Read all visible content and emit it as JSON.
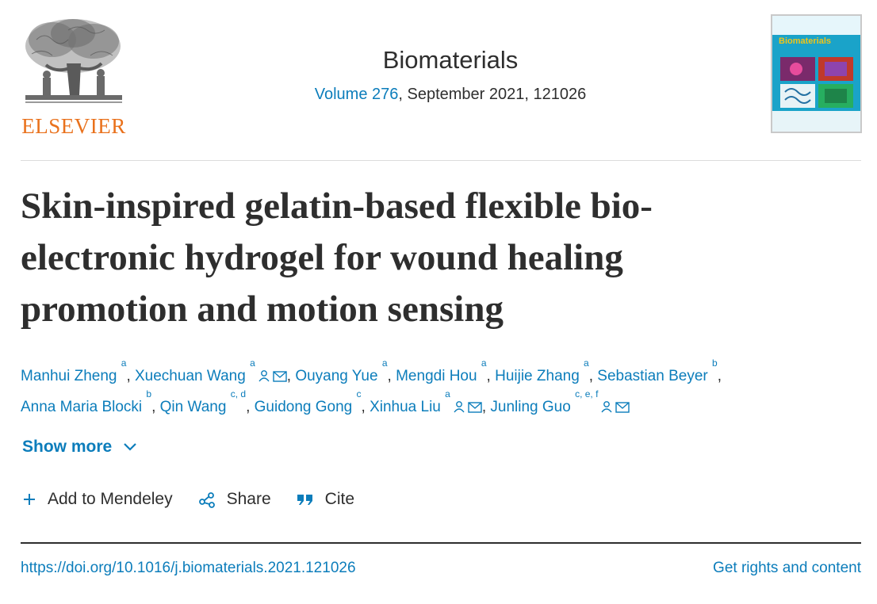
{
  "header": {
    "publisher": "ELSEVIER",
    "journal_title": "Biomaterials",
    "volume_link": "Volume 276",
    "issue_info": ", September 2021, 121026",
    "cover_title": "Biomaterials"
  },
  "article": {
    "title_lines": [
      "Skin-inspired gelatin-based flexible bio-",
      "electronic hydrogel for wound healing",
      "promotion and motion sensing"
    ]
  },
  "authors": [
    {
      "name": "Manhui Zheng",
      "aff": "a",
      "icons": false
    },
    {
      "name": "Xuechuan Wang",
      "aff": "a",
      "icons": true
    },
    {
      "name": "Ouyang Yue",
      "aff": "a",
      "icons": false
    },
    {
      "name": "Mengdi Hou",
      "aff": "a",
      "icons": false
    },
    {
      "name": "Huijie Zhang",
      "aff": "a",
      "icons": false
    },
    {
      "name": "Sebastian Beyer",
      "aff": "b",
      "icons": false
    },
    {
      "name": "Anna Maria Blocki",
      "aff": "b",
      "icons": false
    },
    {
      "name": "Qin Wang",
      "aff": "c, d",
      "icons": false
    },
    {
      "name": "Guidong Gong",
      "aff": "c",
      "icons": false
    },
    {
      "name": "Xinhua Liu",
      "aff": "a",
      "icons": true
    },
    {
      "name": "Junling Guo",
      "aff": "c, e, f",
      "icons": true
    }
  ],
  "controls": {
    "show_more": "Show more",
    "add_to_mendeley": "Add to Mendeley",
    "share": "Share",
    "cite": "Cite"
  },
  "footer": {
    "doi": "https://doi.org/10.1016/j.biomaterials.2021.121026",
    "rights": "Get rights and content"
  },
  "colors": {
    "link": "#0c7dbb",
    "text": "#2e2e2e",
    "publisher_orange": "#e9711c"
  }
}
